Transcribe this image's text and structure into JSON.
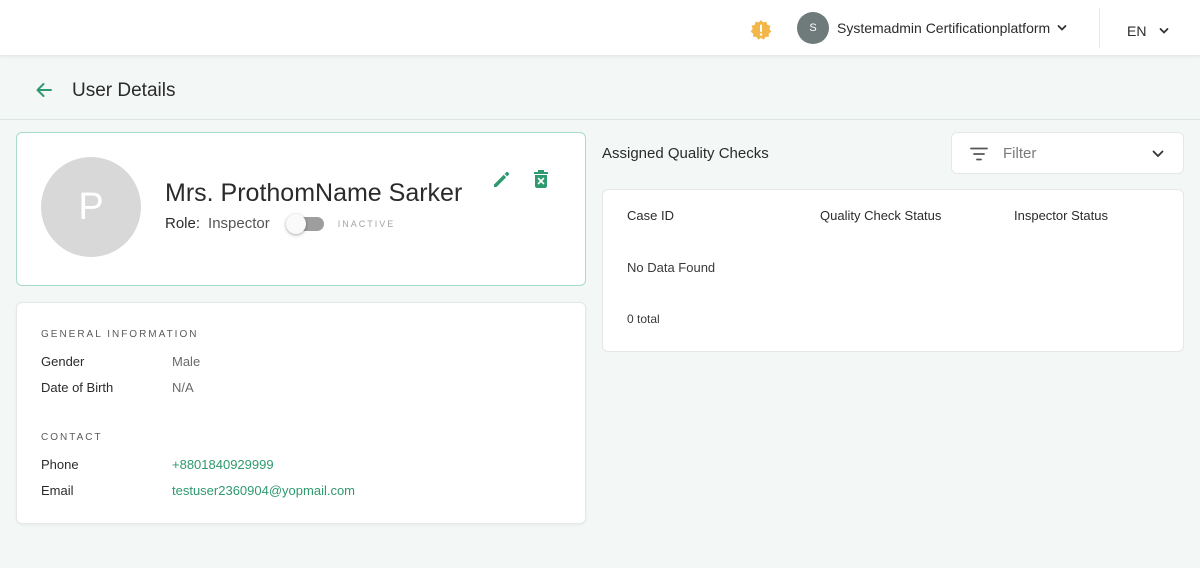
{
  "topbar": {
    "notification_icon": "alert-badge-icon",
    "notification_color": "#f2b74a",
    "user_initial": "S",
    "user_name": "Systemadmin Certificationplatform",
    "language": "EN"
  },
  "page": {
    "title": "User Details"
  },
  "profile": {
    "avatar_initial": "P",
    "full_name": "Mrs. ProthomName Sarker",
    "role_label": "Role:",
    "role_value": "Inspector",
    "status_label": "INACTIVE",
    "active": false,
    "accent_color": "#2f9a6f"
  },
  "general_info": {
    "section_title": "GENERAL INFORMATION",
    "gender_label": "Gender",
    "gender_value": "Male",
    "dob_label": "Date of Birth",
    "dob_value": "N/A"
  },
  "contact": {
    "section_title": "CONTACT",
    "phone_label": "Phone",
    "phone_value": "+8801840929999",
    "email_label": "Email",
    "email_value": "testuser2360904@yopmail.com"
  },
  "quality_checks": {
    "title": "Assigned Quality Checks",
    "filter_placeholder": "Filter",
    "columns": [
      "Case ID",
      "Quality Check Status",
      "Inspector Status"
    ],
    "empty_message": "No Data Found",
    "total_text": "0 total"
  }
}
